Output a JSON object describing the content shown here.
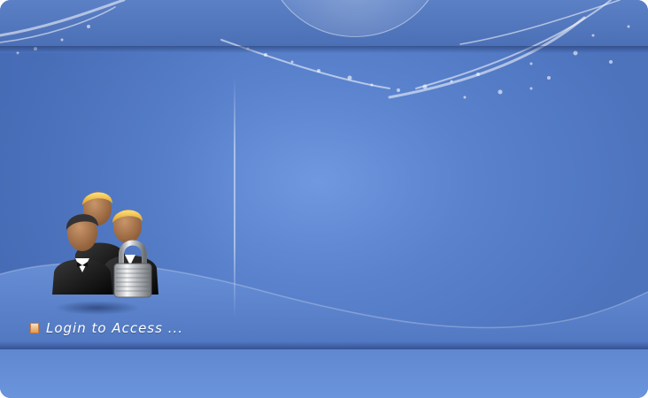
{
  "login": {
    "label": "Login to Access ..."
  },
  "icons": {
    "hero": "users-with-padlock-icon",
    "bullet": "bullet-icon"
  },
  "colors": {
    "background": "#5a82cd",
    "highlight": "#6f98e0",
    "bullet": "#e39a4c",
    "text": "#ffffff"
  }
}
